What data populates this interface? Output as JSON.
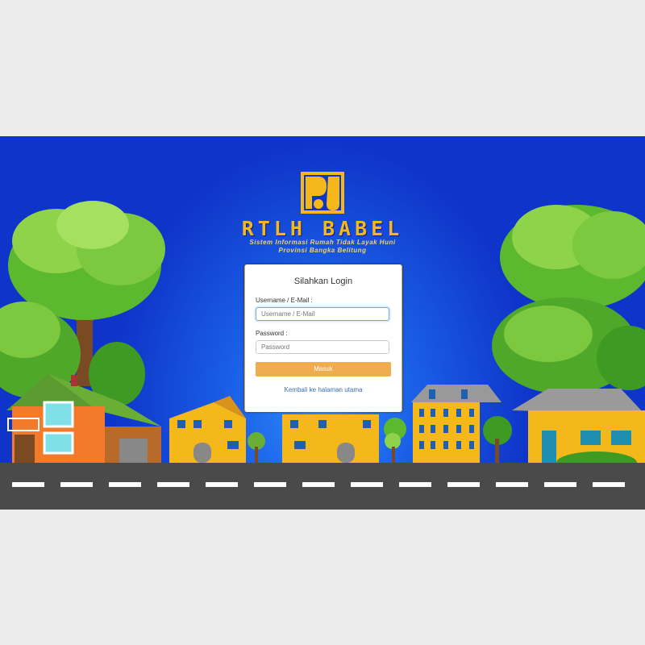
{
  "brand": {
    "title": "RTLH BABEL",
    "subtitle_line1": "Sistem Informasi Rumah Tidak Layak Huni",
    "subtitle_line2": "Provinsi Bangka Belitung",
    "logo_icon": "pu-logo-icon"
  },
  "login": {
    "title": "Silahkan Login",
    "username_label": "Username / E-Mail :",
    "username_placeholder": "Username / E-Mail",
    "password_label": "Password :",
    "password_placeholder": "Password",
    "submit_label": "Masuk",
    "back_link": "Kembali ke halaman utama"
  },
  "colors": {
    "background_blue": "#1a5fe6",
    "brand_gold": "#f5b81a",
    "button_orange": "#f0ad4e",
    "link_blue": "#3a6fb0",
    "road": "#4a4a4a"
  }
}
